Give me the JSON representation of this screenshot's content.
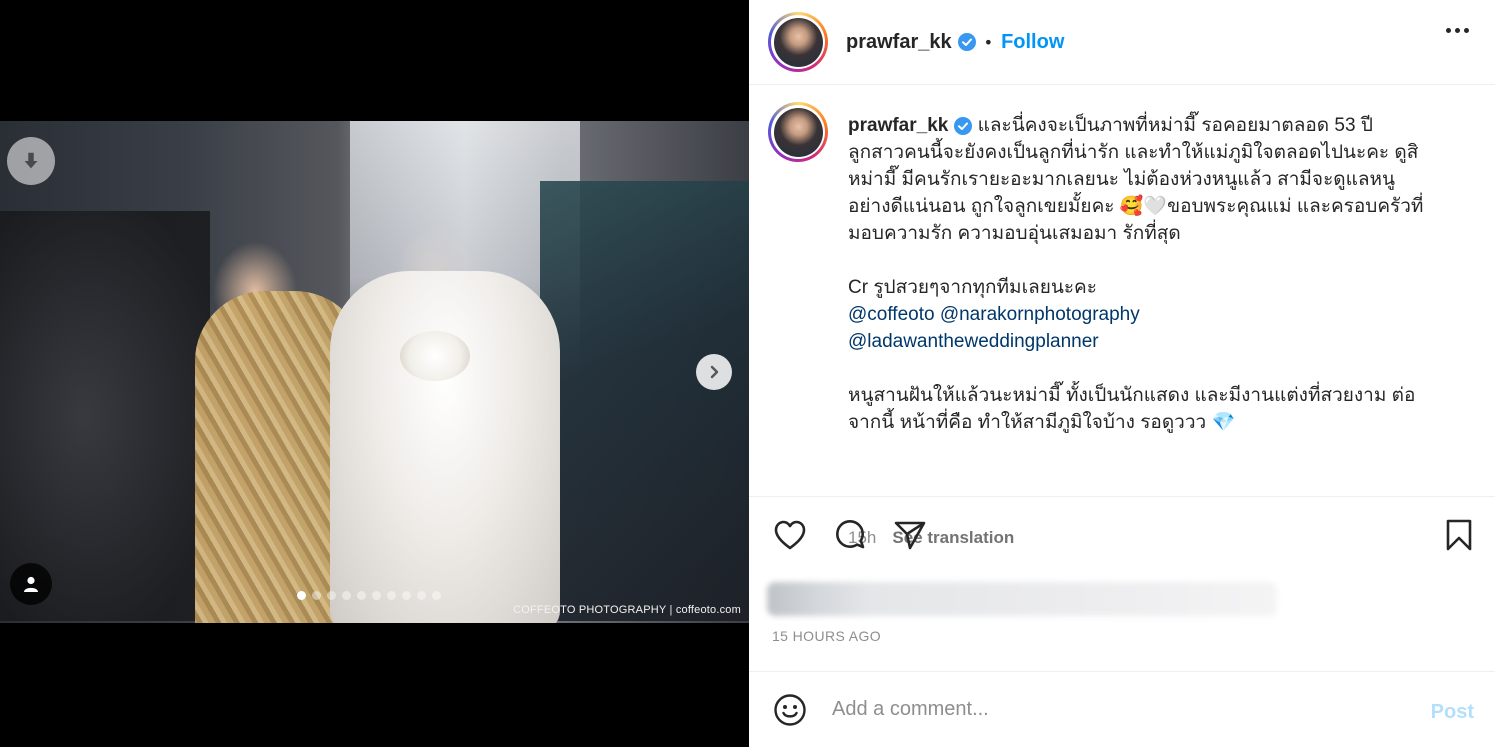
{
  "colors": {
    "accent": "#0095f6",
    "mention": "#00376b",
    "muted": "#8e8e8e",
    "post_disabled": "#b2dffc",
    "verified": "#3897f0"
  },
  "media": {
    "watermark": "COFFEOTO PHOTOGRAPHY | coffeoto.com",
    "carousel_total": 10,
    "carousel_active": 1,
    "icons": {
      "download": "download-icon",
      "next": "chevron-right-icon",
      "tag": "user-icon"
    }
  },
  "header": {
    "username": "prawfar_kk",
    "bullet": "•",
    "follow_label": "Follow",
    "more_icon": "more-horizontal-icon"
  },
  "caption": {
    "username": "prawfar_kk",
    "lines": [
      "และนี่คงจะเป็นภาพที่หม่ามี๊ รอคอยมาตลอด 53 ปี",
      "ลูกสาวคนนี้จะยังคงเป็นลูกที่น่ารัก และทำให้แม่ภูมิใจตลอดไปนะคะ ดูสิ",
      "หม่ามี๊ มีคนรักเรายะอะมากเลยนะ ไม่ต้องห่วงหนูแล้ว สามีจะดูแลหนู",
      "อย่างดีแน่นอน ถูกใจลูกเขยมั้ยคะ 🥰🤍ขอบพระคุณแม่ และครอบครัวที่",
      "มอบความรัก ความอบอุ่นเสมอมา รักที่สุด"
    ],
    "credit": "Cr รูปสวยๆจากทุกทีมเลยนะคะ",
    "mentions_line1": "@coffeoto @narakornphotography",
    "mentions_line2": "@ladawantheweddingplanner",
    "closing_lines": [
      "หนูสานฝันให้แล้วนะหม่ามี๊ ทั้งเป็นนักแสดง และมีงานแต่งที่สวยงาม ต่อ",
      "จากนี้ หน้าที่คือ ทำให้สามีภูมิใจบ้าง รอดูววว 💎"
    ],
    "age": "15h",
    "see_translation": "See translation"
  },
  "actions": {
    "like_icon": "heart-icon",
    "comment_icon": "comment-icon",
    "share_icon": "send-icon",
    "save_icon": "bookmark-icon"
  },
  "timestamp": "15 HOURS AGO",
  "comment_box": {
    "emoji_icon": "emoji-icon",
    "placeholder": "Add a comment...",
    "post_label": "Post"
  }
}
